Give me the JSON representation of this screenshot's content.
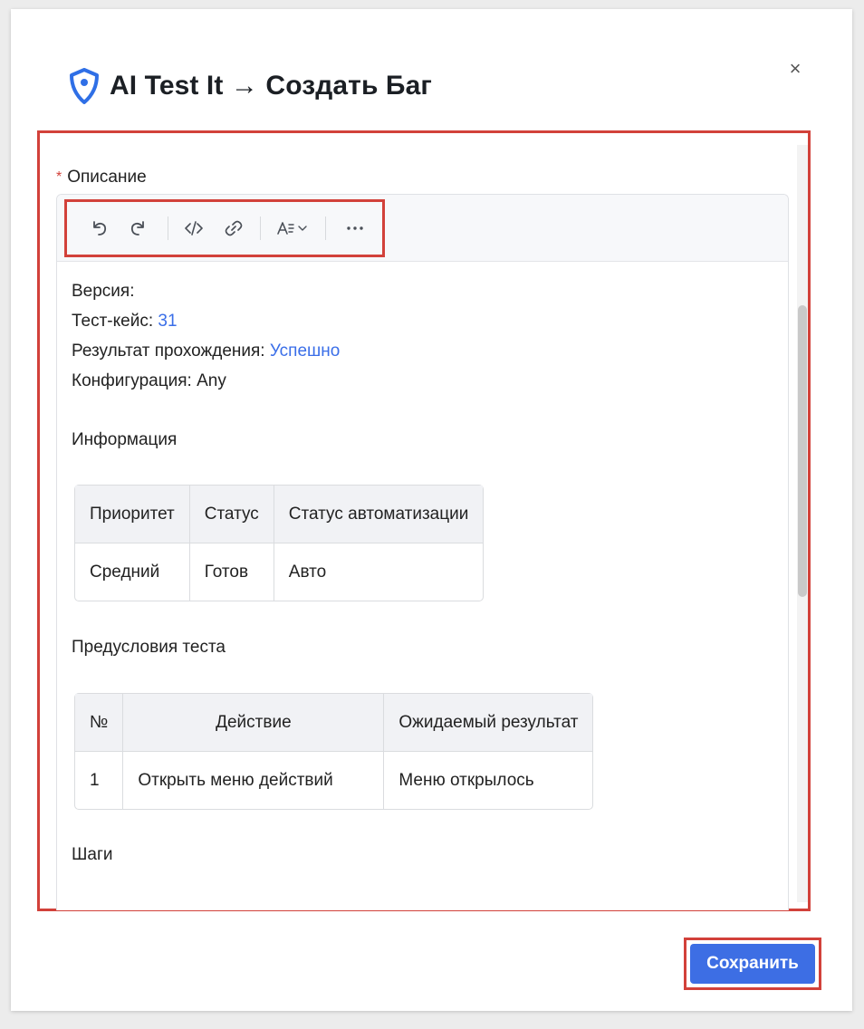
{
  "dialog": {
    "title": "AI Test It → Создать Баг",
    "close_symbol": "×",
    "logo_icon": "shield-pin-logo",
    "brand_color": "#3a6ee8"
  },
  "field": {
    "required_mark": "*",
    "label": "Описание"
  },
  "toolbar": {
    "buttons": [
      {
        "name": "undo",
        "icon": "undo-icon"
      },
      {
        "name": "redo",
        "icon": "redo-icon"
      },
      {
        "name": "code",
        "icon": "code-icon"
      },
      {
        "name": "link",
        "icon": "link-icon"
      },
      {
        "name": "text-format",
        "icon": "text-format-icon"
      },
      {
        "name": "more",
        "icon": "more-icon"
      }
    ]
  },
  "content": {
    "version_label": "Версия:",
    "testcase_label": "Тест-кейс:",
    "testcase_value": "31",
    "result_label": "Результат прохождения:",
    "result_value": "Успешно",
    "config_label": "Конфигурация:",
    "config_value": "Any",
    "info_title": "Информация",
    "info_table": {
      "headers": [
        "Приоритет",
        "Статус",
        "Статус автоматизации"
      ],
      "row": [
        "Средний",
        "Готов",
        "Авто"
      ]
    },
    "preconditions_title": "Предусловия теста",
    "preconditions_table": {
      "headers": [
        "№",
        "Действие",
        "Ожидаемый результат"
      ],
      "row": [
        "1",
        "Открыть меню действий",
        "Меню открылось"
      ]
    },
    "steps_title": "Шаги"
  },
  "footer": {
    "save_label": "Сохранить",
    "save_color": "#3d6ee4"
  },
  "highlight_color": "#d2413a"
}
